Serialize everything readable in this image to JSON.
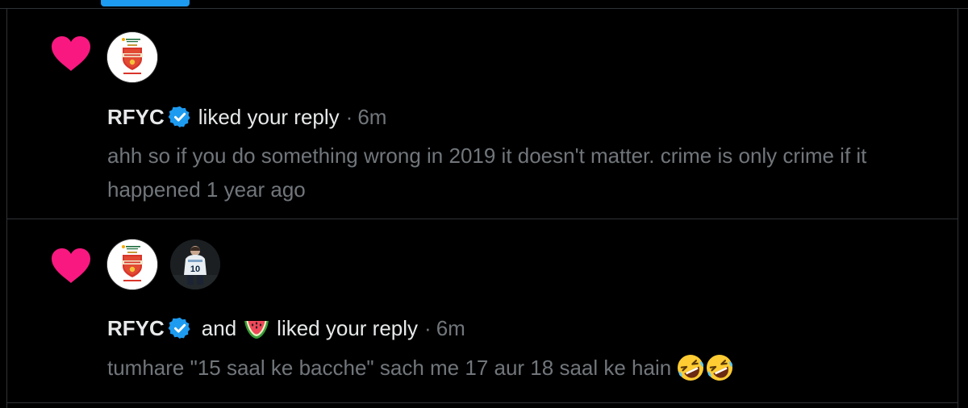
{
  "colors": {
    "background": "#000000",
    "divider": "#2f3336",
    "accent": "#1d9bf0",
    "heart": "#f91880",
    "primary_text": "#e7e9ea",
    "secondary_text": "#71767b"
  },
  "notifications": [
    {
      "type": "like",
      "icon": "heart-icon",
      "avatars": [
        "rfyc-logo-avatar"
      ],
      "actor": "RFYC",
      "verified": true,
      "action": "liked your reply",
      "separator": "·",
      "time": "6m",
      "reply_text": "ahh so if you do something wrong in 2019 it doesn't matter. crime is only crime if it happened 1 year ago"
    },
    {
      "type": "like",
      "icon": "heart-icon",
      "avatars": [
        "rfyc-logo-avatar",
        "footballer-avatar"
      ],
      "actor": "RFYC",
      "verified": true,
      "conjunction": "and",
      "second_actor_icon": "watermelon-icon",
      "action": "liked your reply",
      "separator": "·",
      "time": "6m",
      "reply_text": "tumhare \"15 saal ke bacche\" sach me 17 aur 18 saal ke hain",
      "reply_emojis": [
        "rolling-on-floor-laughing-icon",
        "rolling-on-floor-laughing-icon"
      ]
    }
  ]
}
